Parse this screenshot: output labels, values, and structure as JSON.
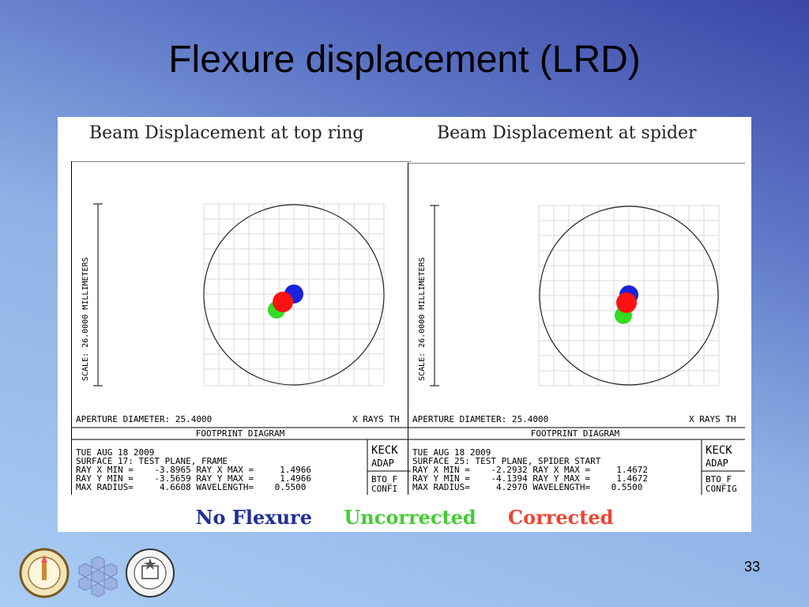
{
  "slide": {
    "title": "Flexure displacement (LRD)",
    "page_number": "33"
  },
  "plots": [
    {
      "heading": "Beam Displacement at top ring",
      "scale_label": "SCALE: 26.0000 MILLIMETERS",
      "aperture": "APERTURE DIAMETER: 25.4000",
      "rays": "X RAYS TH",
      "diagram": "FOOTPRINT DIAGRAM",
      "date": "TUE AUG 18 2009",
      "surface": "SURFACE 17: TEST PLANE, FRAME",
      "ray_x": "RAY X MIN =    -3.8965 RAY X MAX =     1.4966",
      "ray_y": "RAY Y MIN =    -3.5659 RAY Y MAX =     1.4966",
      "radius": "MAX RADIUS=     4.6608 WAVELENGTH=    0.5500",
      "box1": "KECK",
      "box2": "ADAP",
      "box3": "BTO_F",
      "box4": "CONFI"
    },
    {
      "heading": "Beam Displacement at spider",
      "scale_label": "SCALE: 26.0000 MILLIMETERS",
      "aperture": "APERTURE DIAMETER: 25.4000",
      "rays": "X RAYS TH",
      "diagram": "FOOTPRINT DIAGRAM",
      "date": "TUE AUG 18 2009",
      "surface": "SURFACE 25: TEST PLANE, SPIDER START",
      "ray_x": "RAY X MIN =    -2.2932 RAY X MAX =     1.4672",
      "ray_y": "RAY Y MIN =    -4.1394 RAY Y MAX =     1.4672",
      "radius": "MAX RADIUS=     4.2970 WAVELENGTH=    0.5500",
      "box1": "KECK",
      "box2": "ADAP",
      "box3": "BTO_F",
      "box4": "CONFIG"
    }
  ],
  "legend": {
    "no_flexure": "No Flexure",
    "uncorrected": "Uncorrected",
    "corrected": "Corrected",
    "colors": {
      "no_flexure": "#1f2f9a",
      "uncorrected": "#44cc33",
      "corrected": "#ee4433"
    }
  }
}
